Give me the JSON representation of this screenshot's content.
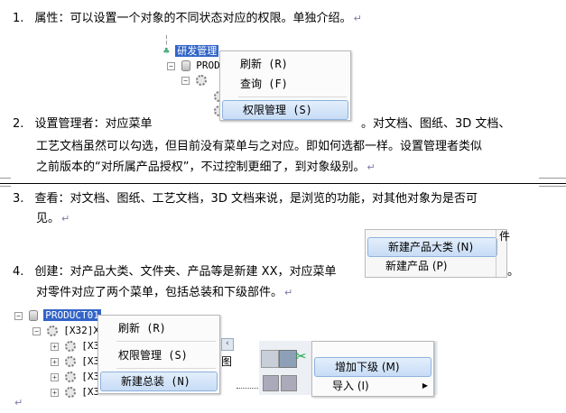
{
  "items": [
    {
      "num": "1.",
      "text": "属性：可以设置一个对象的不同状态对应的权限。单独介绍。"
    },
    {
      "num": "2.",
      "text_a": "设置管理者：对应菜单",
      "text_b": "。对文档、图纸、3D 文档、",
      "line2": "工艺文档虽然可以勾选，但目前没有菜单与之对应。即如何选都一样。设置管理者类似",
      "line3": "之前版本的“对所属产品授权”，不过控制更细了，到对象级别。"
    },
    {
      "num": "3.",
      "text": "查看：对文档、图纸、工艺文档，3D 文档来说，是浏览的功能，对其他对象为是否可",
      "line2": "见。"
    },
    {
      "num": "4.",
      "text_a": "创建：对产品大类、文件夹、产品等是新建 XX，对应菜单",
      "text_b": "。",
      "line2": "对零件对应了两个菜单，包括总装和下级部件。"
    }
  ],
  "para_mark": "↵",
  "fig1": {
    "tree_top": "研发管理",
    "tree_prod": "PROD",
    "menu": [
      "刷新 (R)",
      "查询 (F)",
      "权限管理 (S)"
    ]
  },
  "fig2": {
    "menu": [
      "新建产品大类 (N)",
      "新建产品 (P)"
    ],
    "frag": "件"
  },
  "fig3": {
    "root": "PRODUCT01",
    "child": "[X32]X",
    "rows": [
      "[X3",
      "[X3",
      "[X3",
      "[X3"
    ],
    "menu": [
      "刷新 (R)",
      "权限管理 (S)",
      "新建总装 (N)"
    ],
    "side_char": "图"
  },
  "fig4": {
    "menu": [
      "增加下级 (M)",
      "导入 (I)"
    ],
    "icon_char": "✂"
  }
}
